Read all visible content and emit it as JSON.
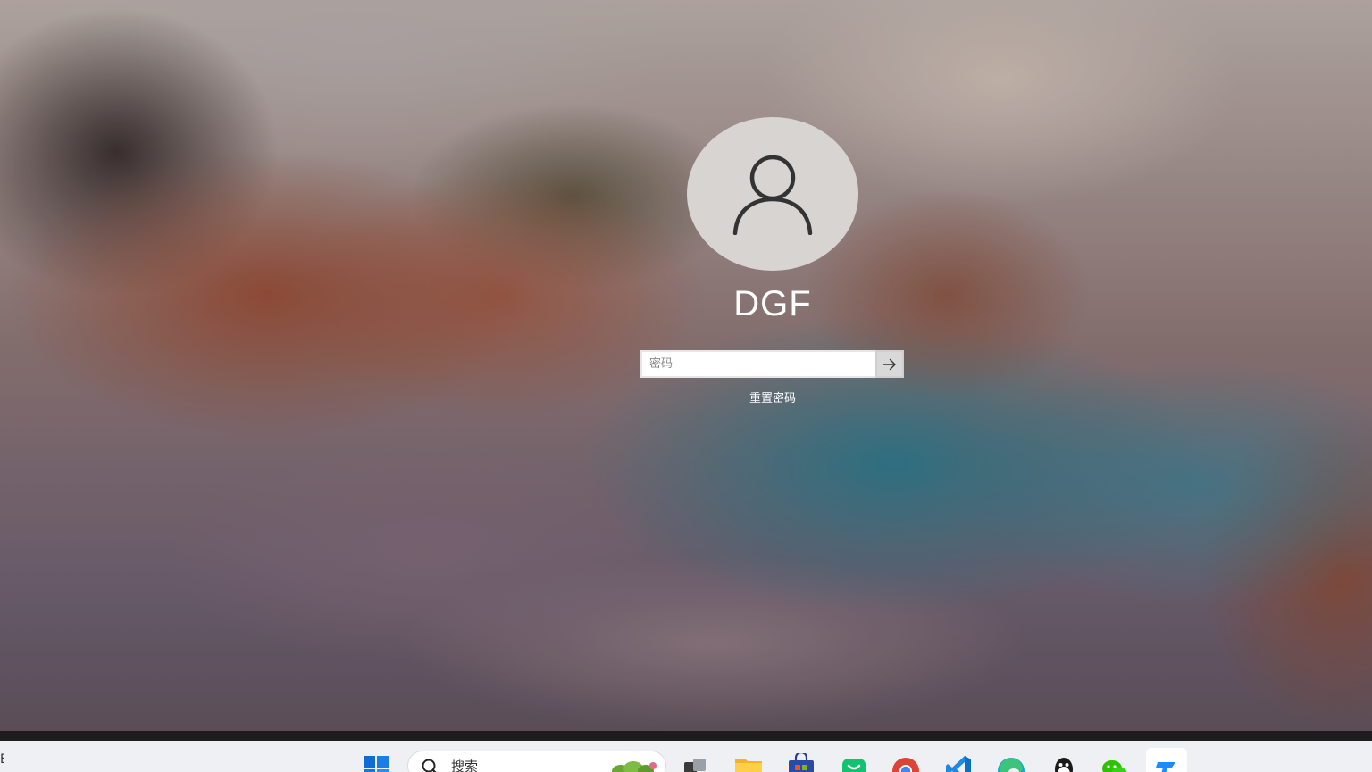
{
  "login": {
    "username": "DGF",
    "password_placeholder": "密码",
    "reset_password_label": "重置密码"
  },
  "taskbar": {
    "left_edge_glyph": "E",
    "search_placeholder": "搜索",
    "items": [
      {
        "name": "start-icon"
      },
      {
        "name": "task-view-icon"
      },
      {
        "name": "file-explorer-icon"
      },
      {
        "name": "microsoft-store-icon"
      },
      {
        "name": "chat-app-icon"
      },
      {
        "name": "chrome-icon"
      },
      {
        "name": "vscode-icon"
      },
      {
        "name": "edge-icon"
      },
      {
        "name": "qq-icon"
      },
      {
        "name": "wechat-icon"
      },
      {
        "name": "active-app-icon"
      }
    ]
  },
  "colors": {
    "avatar_bg": "#d7d4d2",
    "taskbar_bg": "#eef0f3",
    "windows_blue": "#0078d4"
  }
}
